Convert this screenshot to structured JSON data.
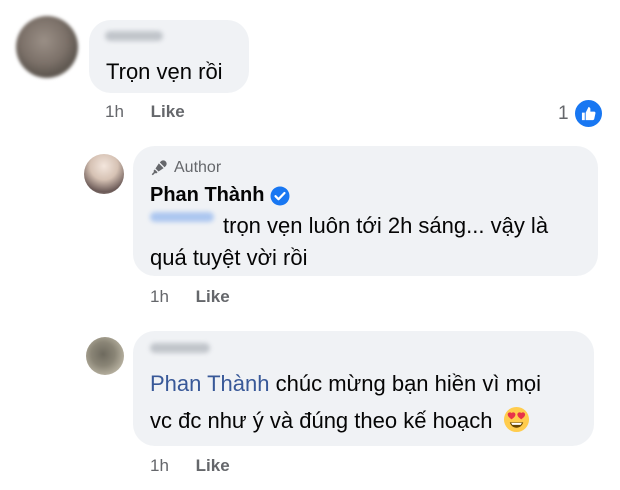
{
  "comments": [
    {
      "text": "Trọn vẹn rồi",
      "time": "1h",
      "like_label": "Like",
      "reaction_count": "1"
    },
    {
      "author_badge": "Author",
      "name": "Phan Thành",
      "text_line1": "trọn vẹn luôn tới 2h sáng... vậy là",
      "text_line2": "quá tuyệt vời rồi",
      "time": "1h",
      "like_label": "Like"
    },
    {
      "mention": "Phan Thành",
      "text_line1": "chúc mừng bạn hiền vì mọi",
      "text_line2": "vc đc như ý và đúng theo kế hoạch",
      "emoji": "heart-eyes-emoji",
      "time": "1h",
      "like_label": "Like"
    }
  ],
  "colors": {
    "bubble": "#f0f2f5",
    "accent": "#1877f2",
    "mention": "#385898",
    "meta": "#65676b"
  }
}
